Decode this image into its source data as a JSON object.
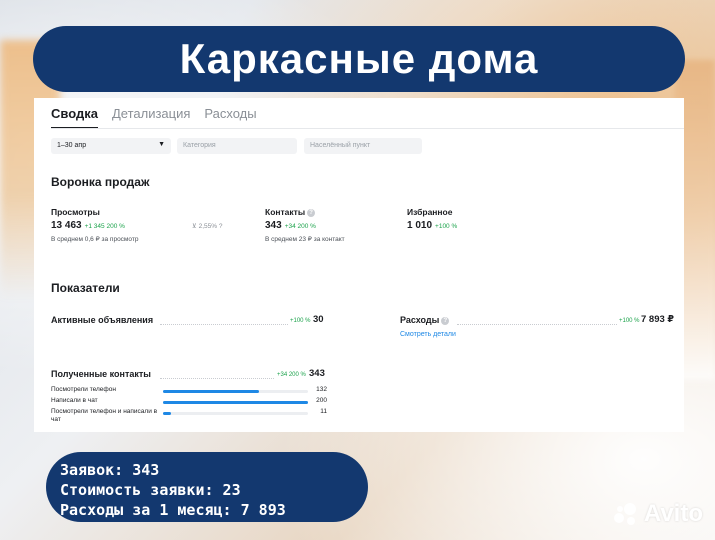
{
  "banner_title": "Каркасные дома",
  "tabs": [
    {
      "label": "Сводка",
      "active": true
    },
    {
      "label": "Детализация",
      "active": false
    },
    {
      "label": "Расходы",
      "active": false
    }
  ],
  "filters": {
    "period": "1–30 апр",
    "category_placeholder": "Категория",
    "city_placeholder": "Населённый пункт"
  },
  "funnel": {
    "title": "Воронка продаж",
    "views": {
      "label": "Просмотры",
      "value": "13 463",
      "delta": "+1 345 200 %",
      "note": "В среднем 0,6 ₽ за просмотр"
    },
    "conversion": "2,55% ?",
    "contacts": {
      "label": "Контакты",
      "value": "343",
      "delta": "+34 200 %",
      "note": "В среднем 23 ₽ за контакт"
    },
    "favorites": {
      "label": "Избранное",
      "value": "1 010",
      "delta": "+100 %"
    }
  },
  "indicators": {
    "title": "Показатели",
    "active_ads": {
      "label": "Активные объявления",
      "delta": "+100 %",
      "value": "30"
    },
    "expenses": {
      "label": "Расходы",
      "delta": "+100 %",
      "value": "7 893 ₽",
      "link": "Смотреть детали"
    },
    "received_contacts": {
      "label": "Полученные контакты",
      "delta": "+34 200 %",
      "value": "343",
      "rows": [
        {
          "label": "Посмотрели телефон",
          "value": "132",
          "share": 0.66
        },
        {
          "label": "Написали в чат",
          "value": "200",
          "share": 1.0
        },
        {
          "label": "Посмотрели телефон и написали в чат",
          "value": "11",
          "share": 0.055
        }
      ]
    }
  },
  "stats": [
    "Заявок: 343",
    "Стоимость заявки: 23",
    "Расходы за 1 месяц: 7 893"
  ],
  "watermark": "Avito",
  "colors": {
    "banner": "#13386f",
    "accent": "#1e88e5",
    "positive": "#1aa24a"
  }
}
